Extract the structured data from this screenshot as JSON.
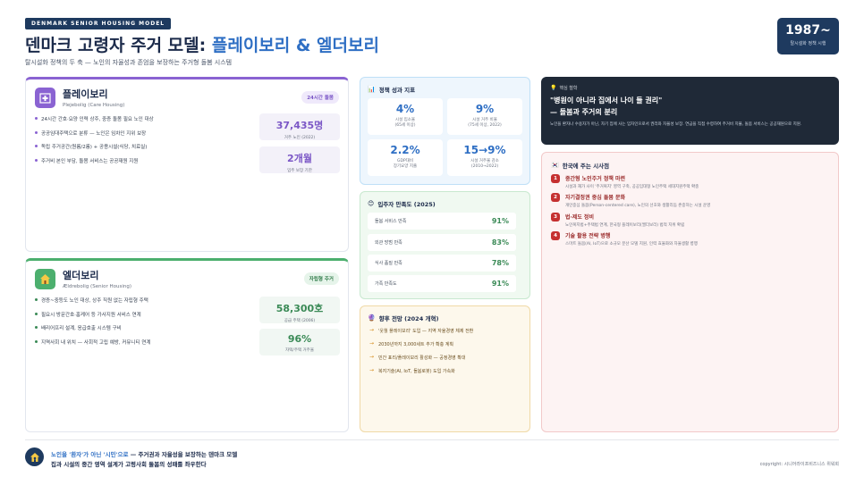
{
  "header": {
    "tag": "DENMARK SENIOR HOUSING MODEL",
    "title_prefix": "덴마크 고령자 주거 모델: ",
    "title_highlight": "플레이보리 & 엘더보리",
    "subtitle": "탈시설화 정책의 두 축 — 노인의 자율성과 존엄을 보장하는 주거형 돌봄 시스템",
    "year": "1987~",
    "year_caption": "탈시설화 정책 시행"
  },
  "pleje": {
    "icon": "hospital-icon",
    "name": "플레이보리",
    "en": "Plejebolig (Care Housing)",
    "chip": "24시간 돌봄",
    "bullets": [
      "24시간 간호·요양 인력 상주, 중증 돌봄 필요 노인 대상",
      "공공임대주택으로 분류 — 노인은 임차인 지위 보장",
      "독립 주거공간(원룸/2룸) + 공용시설(식당, 치료실)",
      "주거비 본인 부담, 돌봄 서비스는 공공재원 지원"
    ],
    "stats": [
      {
        "value": "37,435명",
        "label": "거주 노인 (2022)"
      },
      {
        "value": "2개월",
        "label": "입주 보장 기한"
      }
    ]
  },
  "aelder": {
    "icon": "house-icon",
    "name": "엘더보리",
    "en": "Ældrebolig (Senior Housing)",
    "chip": "자립형 주거",
    "bullets": [
      "경증~중등도 노인 대상, 상주 직원 없는 자립형 주택",
      "필요시 방문간호·홈케어 등 가사지원 서비스 연계",
      "배리어프리 설계, 응급호출 시스템 구비",
      "지역사회 내 위치 — 사회적 고립 예방, 커뮤니티 연계"
    ],
    "stats": [
      {
        "value": "58,300호",
        "label": "공급 주택 (2006)"
      },
      {
        "value": "96%",
        "label": "자택/주택 거주율"
      }
    ]
  },
  "performance": {
    "title": "정책 성과 지표",
    "items": [
      {
        "value": "4%",
        "label1": "시설 입소율",
        "label2": "(65세 이상)"
      },
      {
        "value": "9%",
        "label1": "시설 거주 비율",
        "label2": "(75세 이상, 2022)"
      },
      {
        "value": "2.2%",
        "label1": "GDP대비",
        "label2": "장기요양 지출"
      },
      {
        "value": "15→9%",
        "label1": "시설 거주율 감소",
        "label2": "(2010→2022)"
      }
    ]
  },
  "satisfaction": {
    "title": "입주자 만족도 (2025)",
    "rows": [
      {
        "label": "돌봄 서비스 만족",
        "value": "91%"
      },
      {
        "label": "외관 방범 만족",
        "value": "83%"
      },
      {
        "label": "식사 품질 만족",
        "value": "78%"
      },
      {
        "label": "가족 만족도",
        "value": "91%"
      }
    ]
  },
  "future": {
    "title": "향후 전망 (2024 개혁)",
    "items": [
      "'웃월 플레이보리' 도입 — 지역 자율경영 체제 전환",
      "2030년까지 3,000세트 추가 확충 계획",
      "민간 표리/플레이보리 활성화 — 공정경영 확대",
      "복지기술(AI, IoT, 돌봄로봇) 도입 가속화"
    ]
  },
  "insight": {
    "label": "핵심 철학",
    "quote1": "\"병원이 아니라 집에서 나이 들 권리\"",
    "quote2": "— 돌봄과 주거의 분리",
    "desc": "노인을 환자나 수용자가 아닌, 자기 집에 사는 임차인으로서 권리와 자율성 보장. 연금을 직접 수령하여 주거비 지불, 돌봄 서비스는 공공재원으로 지원."
  },
  "implications": {
    "title": "한국에 주는 시사점",
    "items": [
      {
        "num": "1",
        "title": "중간형 노인주거 정책 마련",
        "desc": "시설과 재가 사이 '주거복지' 영역 구축, 공공임대형 노인주택 세대지원주택 확충"
      },
      {
        "num": "2",
        "title": "자기결정권 중심 돌봄 문화",
        "desc": "개인중심 돌봄(Person-centered care), 노인의 선호와 생활리듬 존중하는 시설 운영"
      },
      {
        "num": "3",
        "title": "법·제도 정비",
        "desc": "노인복지법+주택법 연계, 한국형 플레이보리(엘더보리) 법적 지위 확립"
      },
      {
        "num": "4",
        "title": "기술 활용 전략 병행",
        "desc": "스마트 돌봄(AI, IoT)으로 소규모 분산 모델 지원, 인력 효율화와 자율생활 병행"
      }
    ]
  },
  "footer": {
    "line1_pre": "노인을 ",
    "line1_hl": "'환자'가 아닌 '시민'으로",
    "line1_post": " — 주거권과 자율성을 보장하는 덴마크 모델",
    "line2": "집과 시설의 중간 영역 설계가 고령사회 돌봄의 성패를 좌우한다",
    "copyright": "copyright: 시니어라이프비즈니스 위워회"
  },
  "colors": {
    "navy": "#1e3a5f",
    "accent_blue": "#2f6fc4",
    "purple": "#8a63d2",
    "green": "#4caf6e",
    "red": "#c53030"
  }
}
